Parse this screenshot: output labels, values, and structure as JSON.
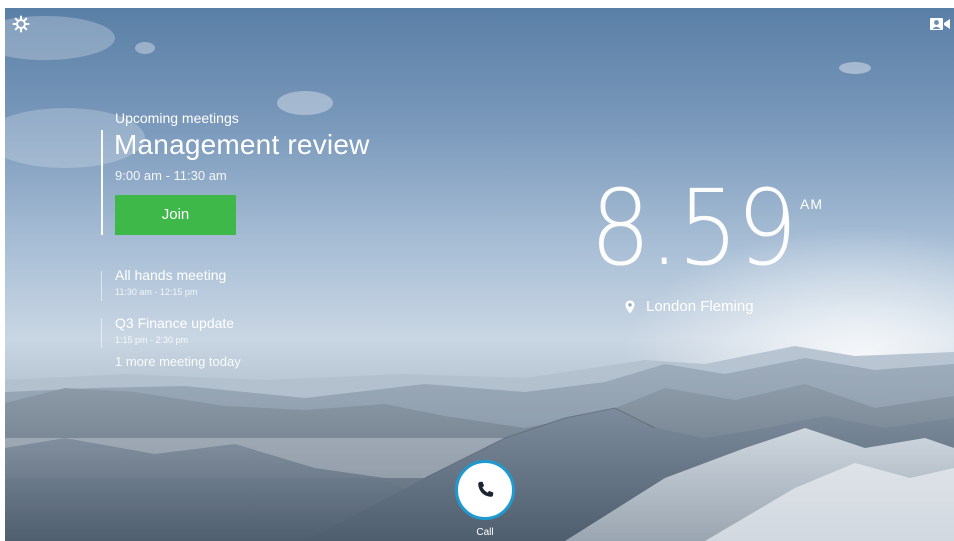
{
  "topbar": {
    "settings_icon": "gear-icon",
    "selfview_icon": "video-camera-icon"
  },
  "meetings": {
    "section_label": "Upcoming meetings",
    "current": {
      "title": "Management review",
      "time": "9:00 am - 11:30 am",
      "join_label": "Join"
    },
    "later": [
      {
        "title": "All hands meeting",
        "time": "11:30 am - 12:15 pm"
      },
      {
        "title": "Q3 Finance update",
        "time": "1:15 pm - 2:30 pm"
      }
    ],
    "more_label": "1 more meeting today"
  },
  "clock": {
    "time": "8.59",
    "period": "AM",
    "location": "London Fleming",
    "location_icon": "map-pin-icon"
  },
  "call": {
    "label": "Call",
    "icon": "phone-icon"
  },
  "colors": {
    "join_green": "#3fb84a",
    "call_ring": "#1f9ad0"
  }
}
